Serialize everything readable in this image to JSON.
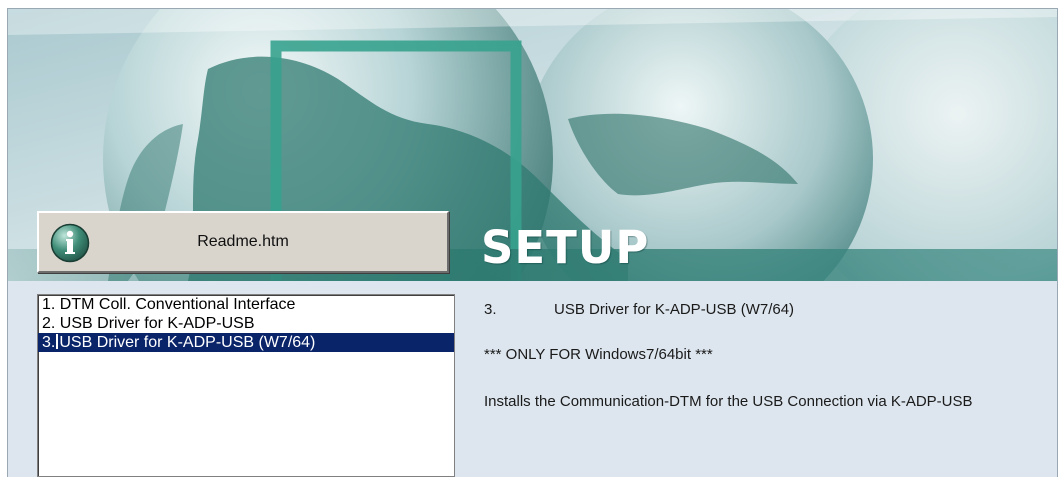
{
  "readme": {
    "label": "Readme.htm",
    "icon": "info-icon"
  },
  "banner": {
    "title": "SETUP"
  },
  "list": {
    "items": [
      {
        "number": "1.",
        "label": "DTM Coll. Conventional Interface",
        "selected": false
      },
      {
        "number": "2.",
        "label": "USB Driver for K-ADP-USB",
        "selected": false
      },
      {
        "number": "3.",
        "label": "USB Driver for K-ADP-USB (W7/64)",
        "selected": true
      }
    ]
  },
  "details": {
    "number": "3.",
    "title": "USB Driver for K-ADP-USB (W7/64)",
    "warning": "*** ONLY FOR Windows7/64bit ***",
    "description": "Installs the Communication-DTM for the USB Connection via K-ADP-USB"
  },
  "colors": {
    "selection": "#0a246a",
    "panel": "#dde6ee",
    "banner_teal": "#2f7f74"
  }
}
